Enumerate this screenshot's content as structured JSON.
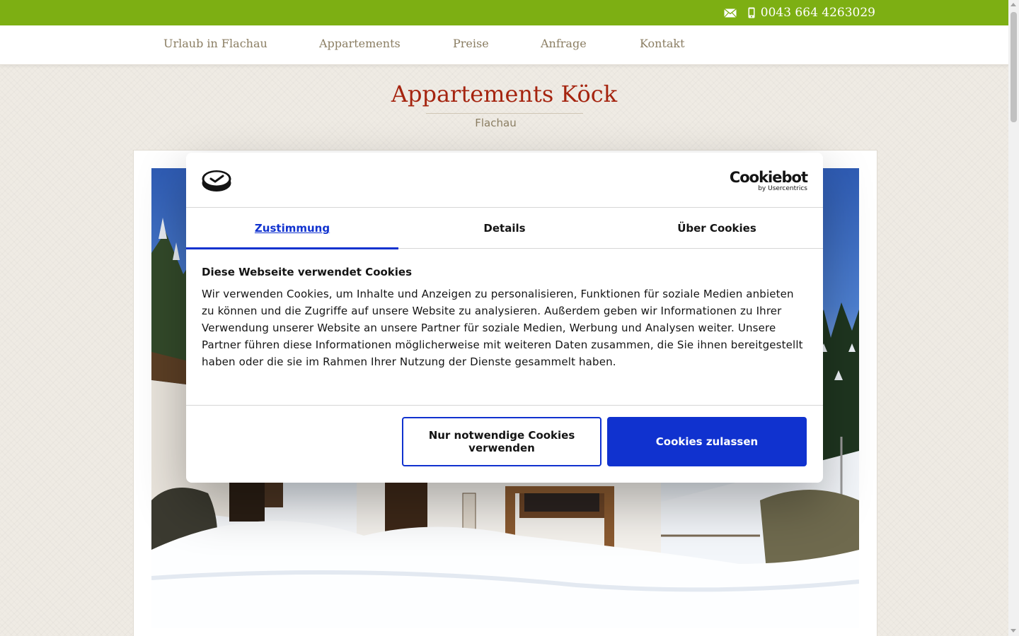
{
  "topbar": {
    "phone": "0043 664 4263029",
    "icons": [
      "mail-icon",
      "mobile-phone-icon"
    ],
    "bg_color": "#7daf13"
  },
  "nav": {
    "items": [
      "Urlaub in Flachau",
      "Appartements",
      "Preise",
      "Anfrage",
      "Kontakt"
    ]
  },
  "header": {
    "title": "Appartements Köck",
    "subtitle": "Flachau",
    "title_color": "#a5240f"
  },
  "cookie_dialog": {
    "brand": "Cookiebot",
    "brand_by": "by Usercentrics",
    "tabs": [
      {
        "label": "Zustimmung",
        "active": true
      },
      {
        "label": "Details",
        "active": false
      },
      {
        "label": "Über Cookies",
        "active": false
      }
    ],
    "heading": "Diese Webseite verwendet Cookies",
    "body": "Wir verwenden Cookies, um Inhalte und Anzeigen zu personalisieren, Funktionen für soziale Medien anbieten zu können und die Zugriffe auf unsere Website zu analysieren. Außerdem geben wir Informationen zu Ihrer Verwendung unserer Website an unsere Partner für soziale Medien, Werbung und Analysen weiter. Unsere Partner führen diese Informationen möglicherweise mit weiteren Daten zusammen, die Sie ihnen bereitgestellt haben oder die sie im Rahmen Ihrer Nutzung der Dienste gesammelt haben.",
    "btn_necessary": "Nur notwendige Cookies verwenden",
    "btn_allow": "Cookies zulassen",
    "accent_color": "#1032cf"
  }
}
